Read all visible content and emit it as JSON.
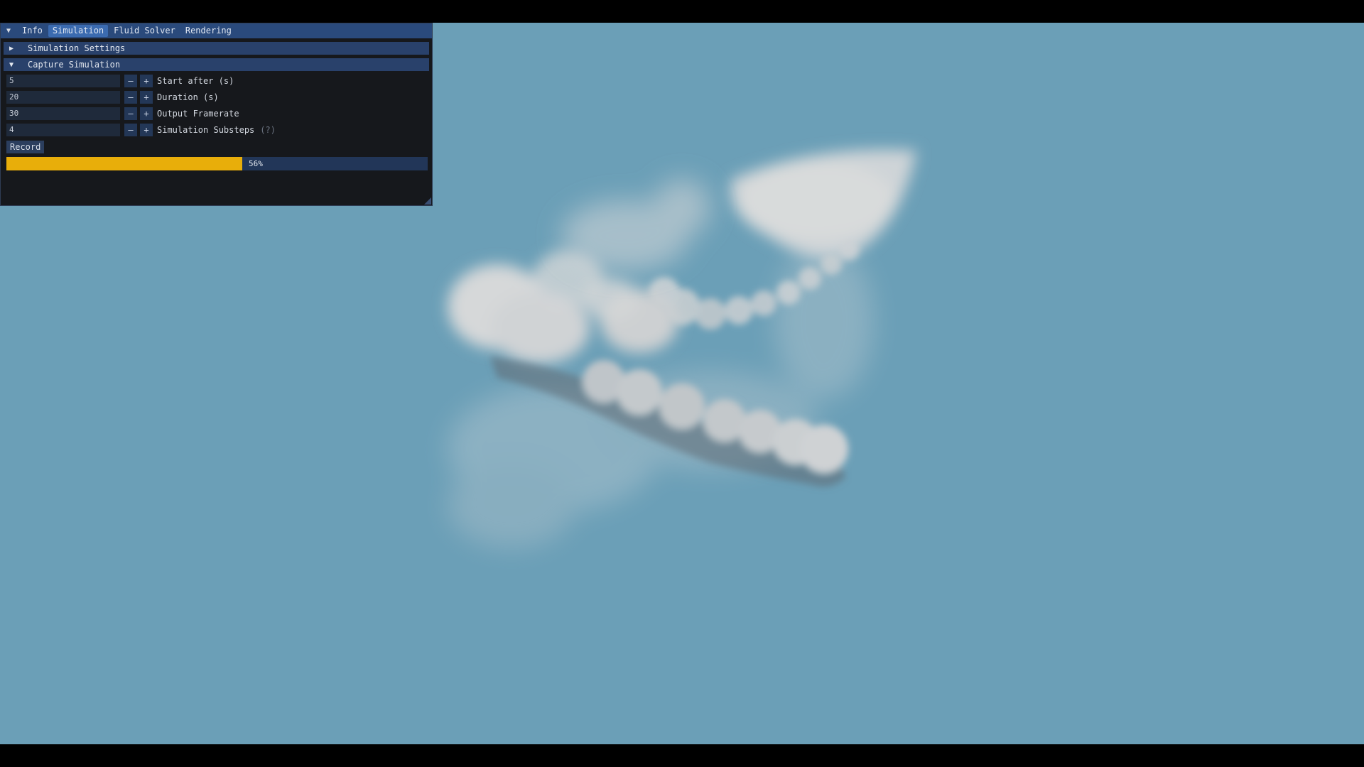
{
  "tabs": [
    {
      "label": "Info"
    },
    {
      "label": "Simulation"
    },
    {
      "label": "Fluid Solver"
    },
    {
      "label": "Rendering"
    }
  ],
  "active_tab": "Simulation",
  "sections": {
    "simulation_settings": {
      "label": "Simulation Settings",
      "expanded": false
    },
    "capture_simulation": {
      "label": "Capture Simulation",
      "expanded": true
    }
  },
  "fields": {
    "start_after": {
      "value": "5",
      "label": "Start after (s)"
    },
    "duration": {
      "value": "20",
      "label": "Duration (s)"
    },
    "output_framerate": {
      "value": "30",
      "label": "Output Framerate"
    },
    "simulation_substeps": {
      "value": "4",
      "label": "Simulation Substeps",
      "hint": "(?)"
    }
  },
  "stepper": {
    "minus": "–",
    "plus": "+"
  },
  "record_button": {
    "label": "Record"
  },
  "progress": {
    "value": 0.56,
    "text": "56%"
  },
  "colors": {
    "sky": "#6b9fb7",
    "progress_fill": "#e8ae0a",
    "tab_bar": "#2a4a7c",
    "panel_bg": "#16181c"
  },
  "icons": {
    "collapse": "triangle-down-icon",
    "expand": "triangle-right-icon"
  }
}
